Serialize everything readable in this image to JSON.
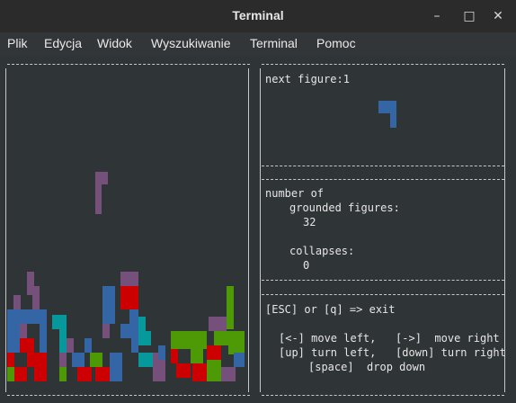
{
  "window": {
    "title": "Terminal",
    "minimize": "–",
    "maximize": "□",
    "close": "✕"
  },
  "menu": [
    "Plik",
    "Edycja",
    "Widok",
    "Wyszukiwanie",
    "Terminal",
    "Pomoc"
  ],
  "panel_next": {
    "label": "next figure:1"
  },
  "panel_stats": {
    "line1": "number of",
    "line2": "grounded figures:",
    "grounded_value": "32",
    "collapses_label": "collapses:",
    "collapses_value": "0"
  },
  "panel_help": {
    "exit": "[ESC] or [q] => exit",
    "row1": "[<-] move left,   [->]  move right",
    "row2": "[up] turn left,   [down] turn right",
    "row3": "[space]  drop down"
  },
  "colors": {
    "purple": "#75507b",
    "blue": "#3465a4",
    "red": "#cc0000",
    "cyan": "#06989a",
    "green": "#4e9a06"
  }
}
